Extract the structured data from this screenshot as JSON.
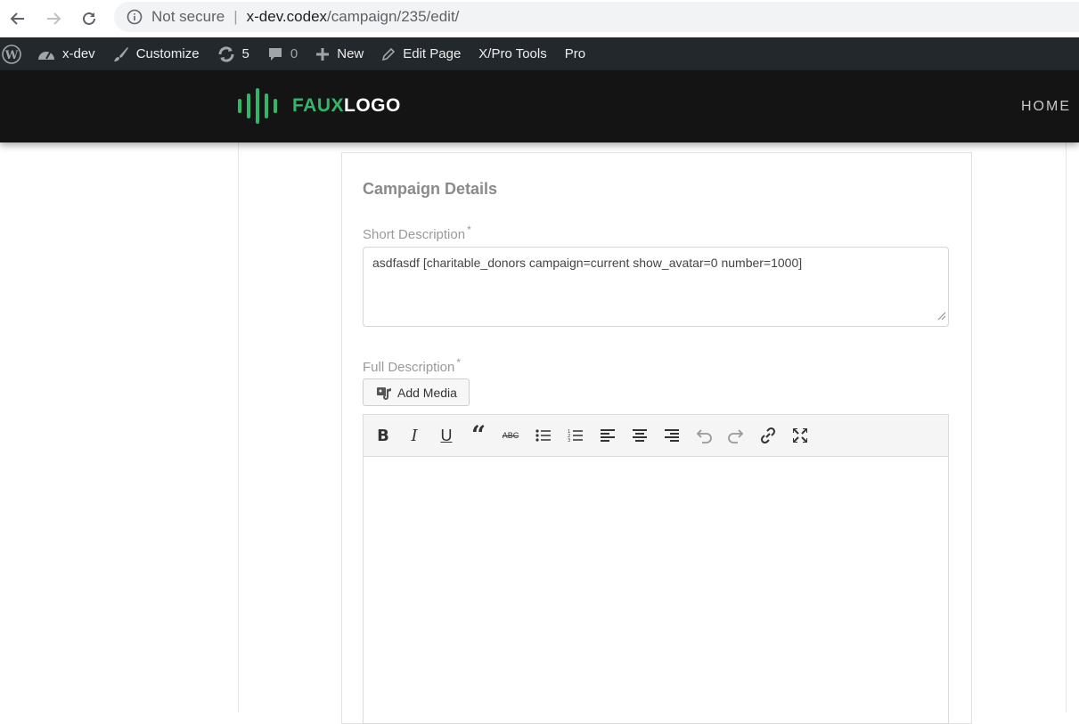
{
  "browser": {
    "security_label": "Not secure",
    "url_host": "x-dev.codex",
    "url_path": "/campaign/235/edit/"
  },
  "adminbar": {
    "site_name": "x-dev",
    "customize": "Customize",
    "updates_count": "5",
    "comments_count": "0",
    "new_label": "New",
    "edit_page": "Edit Page",
    "xpro_tools": "X/Pro Tools",
    "pro": "Pro"
  },
  "header": {
    "logo_part1": "FAUX",
    "logo_part2": "LOGO",
    "nav_home": "HOME",
    "accent_color": "#2fb86a"
  },
  "form": {
    "title": "Campaign Details",
    "short_description": {
      "label": "Short Description",
      "required_mark": "*",
      "value": "asdfasdf [charitable_donors campaign=current show_avatar=0 number=1000]"
    },
    "full_description": {
      "label": "Full Description",
      "required_mark": "*",
      "add_media_label": "Add Media",
      "toolbar_icons": [
        "bold-icon",
        "italic-icon",
        "underline-icon",
        "blockquote-icon",
        "strikethrough-icon",
        "bullet-list-icon",
        "numbered-list-icon",
        "align-left-icon",
        "align-center-icon",
        "align-right-icon",
        "undo-icon",
        "redo-icon",
        "link-icon",
        "fullscreen-icon"
      ]
    }
  }
}
